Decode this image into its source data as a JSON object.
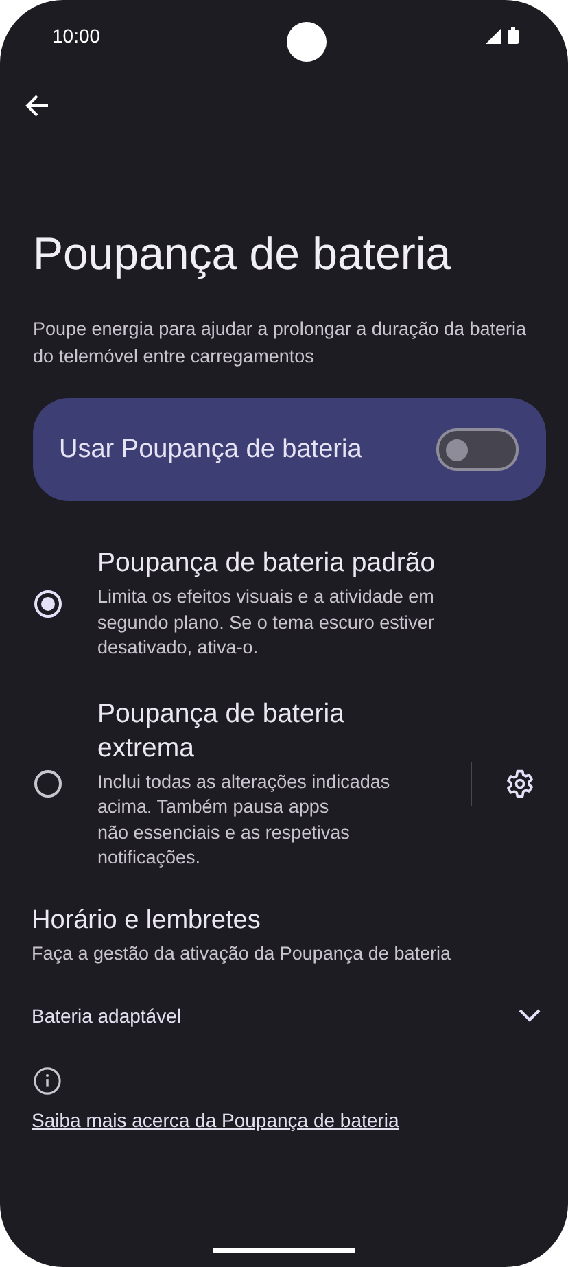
{
  "status_bar": {
    "time": "10:00"
  },
  "title": "Poupança de bateria",
  "description": "Poupe energia para ajudar a prolongar a duração da bateria do telemóvel entre carregamentos",
  "main_toggle": {
    "label": "Usar Poupança de bateria",
    "on": false
  },
  "options": [
    {
      "title": "Poupança de bateria padrão",
      "description": "Limita os efeitos visuais e a atividade em\nsegundo plano. Se o tema escuro estiver\ndesativado, ativa-o.",
      "selected": true,
      "has_settings": false
    },
    {
      "title": "Poupança de bateria\nextrema",
      "description": "Inclui todas as alterações indicadas\nacima. Também pausa apps\nnão essenciais e as respetivas\nnotificações.",
      "selected": false,
      "has_settings": true
    }
  ],
  "schedule": {
    "title": "Horário e lembretes",
    "subtitle": "Faça a gestão da ativação da Poupança de bateria"
  },
  "adaptive": {
    "label": "Bateria adaptável",
    "expanded": false
  },
  "learn_more": "Saiba mais acerca da Poupança de bateria"
}
